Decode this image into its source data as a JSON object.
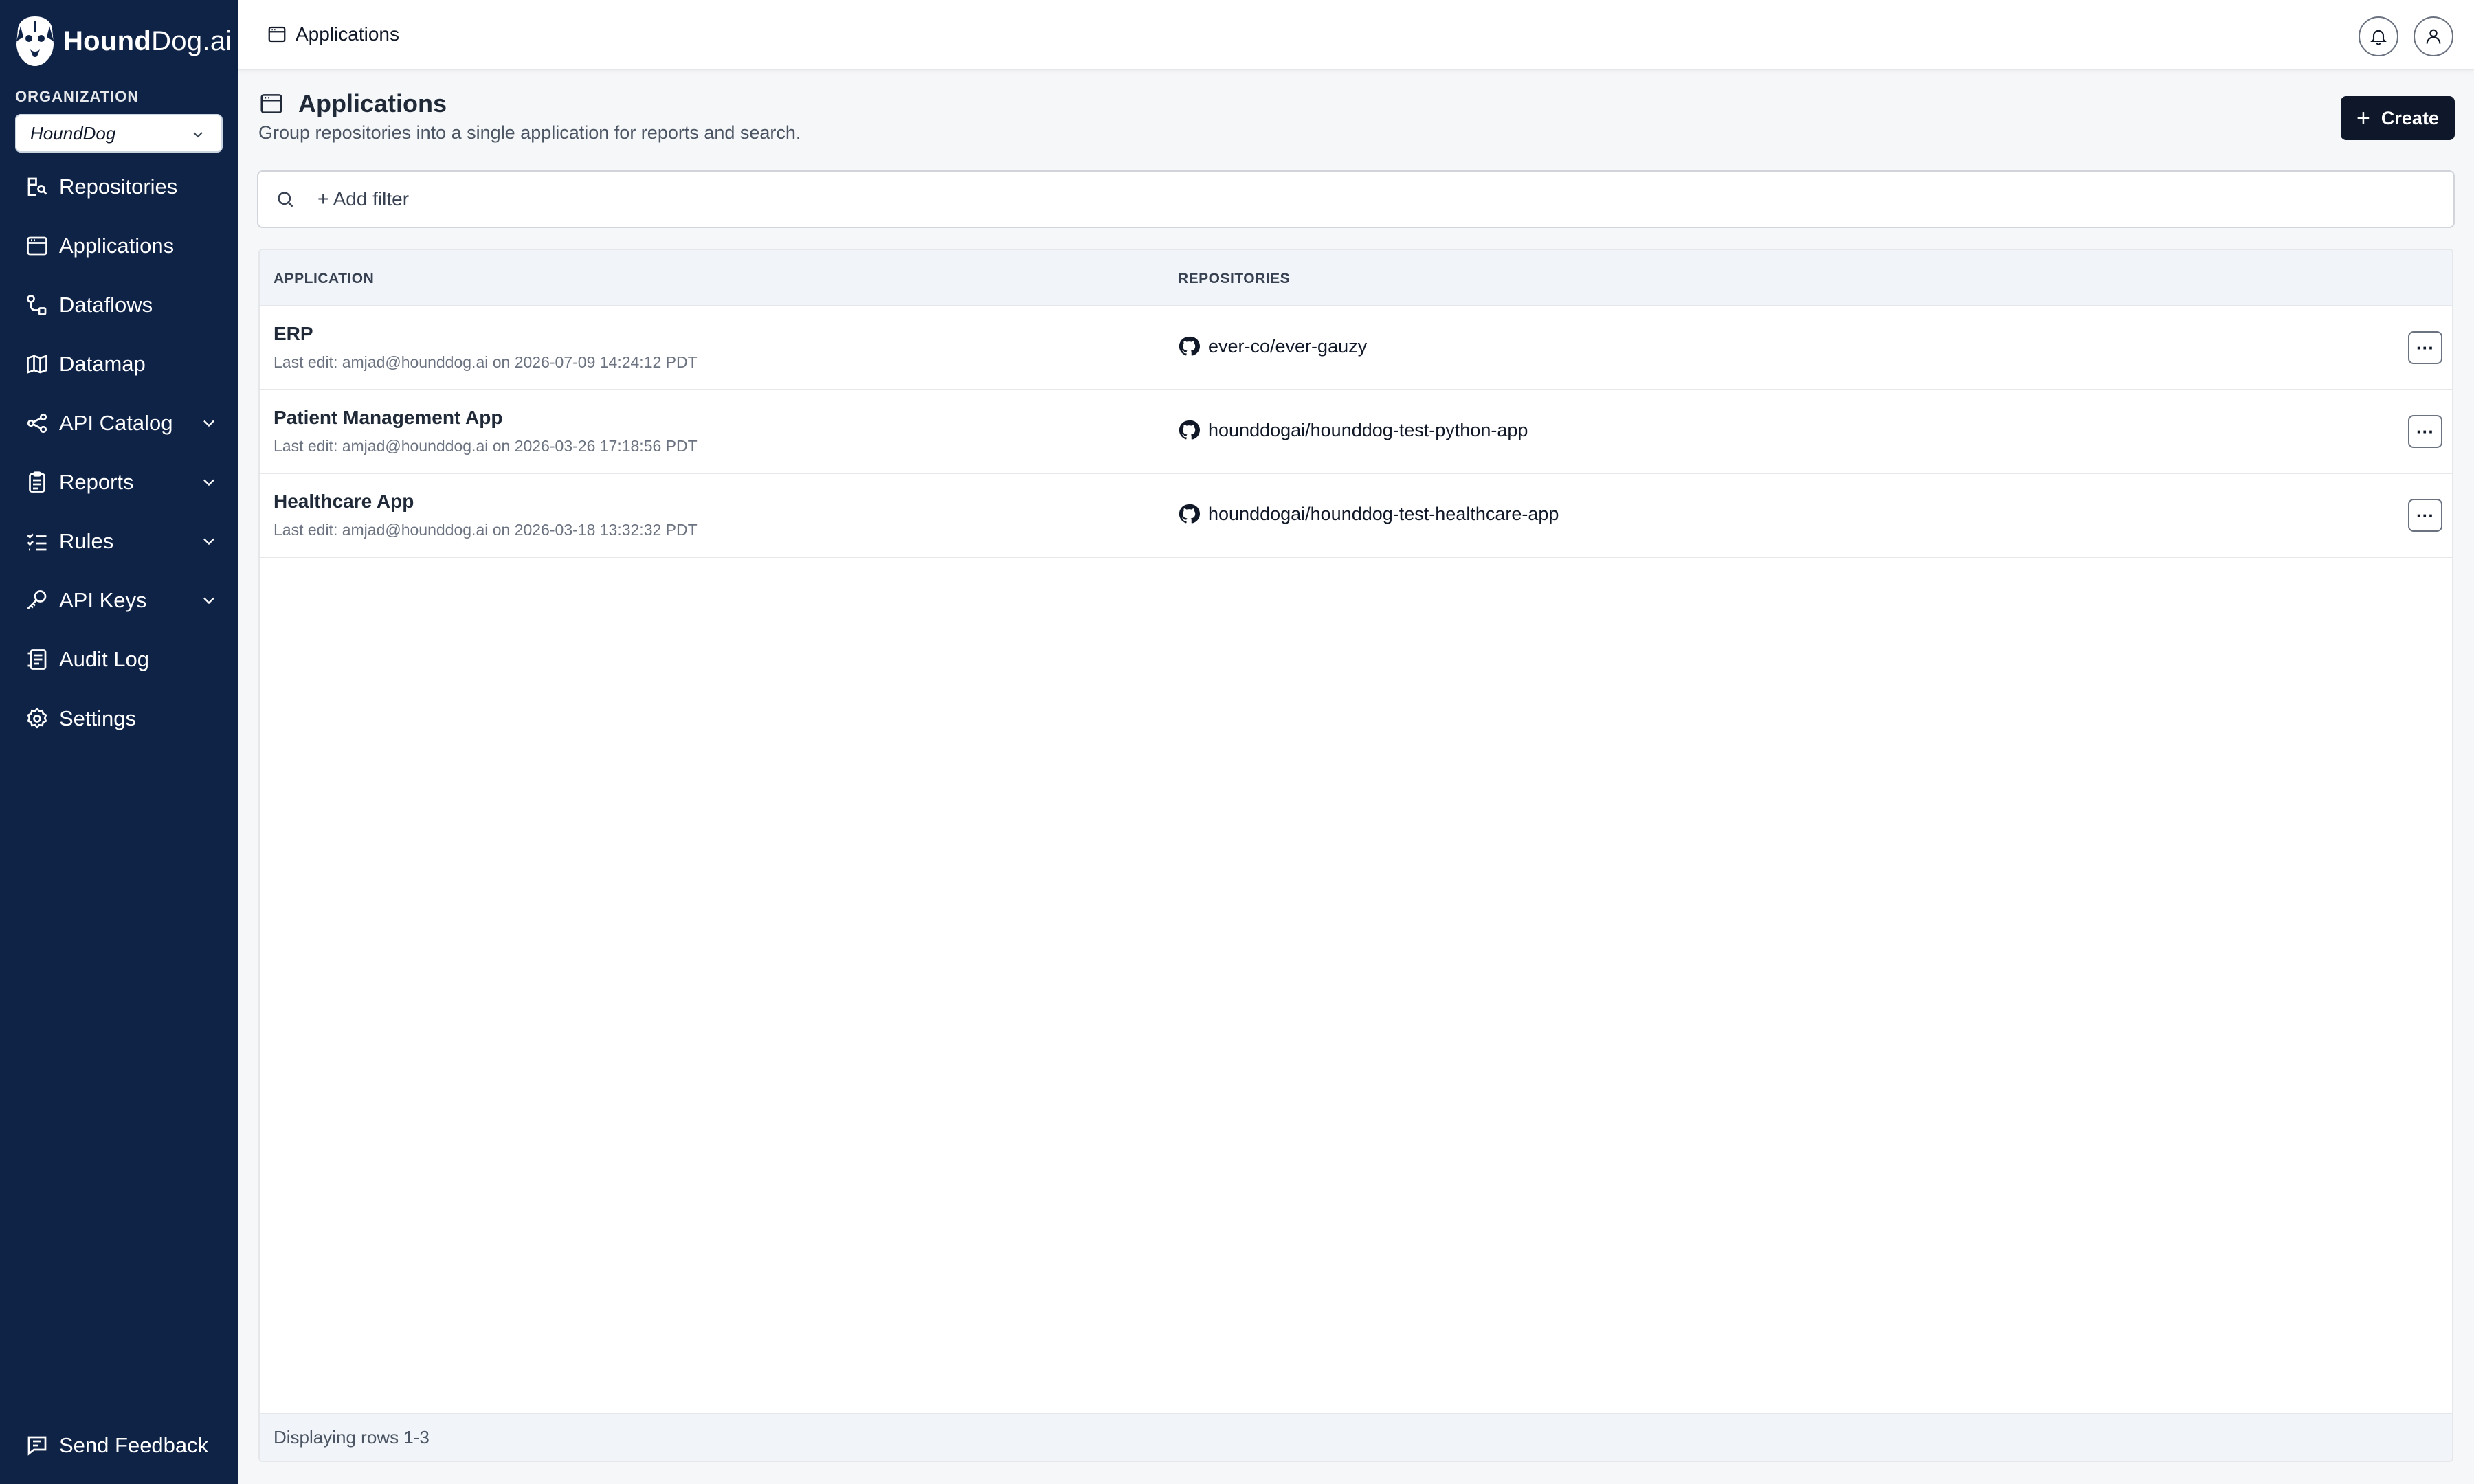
{
  "brand": {
    "name_bold": "Hound",
    "name_rest": "Dog.ai"
  },
  "sidebar": {
    "org_label": "ORGANIZATION",
    "org_value": "HoundDog",
    "items": [
      {
        "label": "Repositories",
        "icon": "repositories-icon"
      },
      {
        "label": "Applications",
        "icon": "applications-icon"
      },
      {
        "label": "Dataflows",
        "icon": "dataflows-icon"
      },
      {
        "label": "Datamap",
        "icon": "map-icon"
      },
      {
        "label": "API Catalog",
        "icon": "api-catalog-icon",
        "expandable": true
      },
      {
        "label": "Reports",
        "icon": "clipboard-icon",
        "expandable": true
      },
      {
        "label": "Rules",
        "icon": "checklist-icon",
        "expandable": true
      },
      {
        "label": "API Keys",
        "icon": "key-icon",
        "expandable": true
      },
      {
        "label": "Audit Log",
        "icon": "audit-log-icon"
      },
      {
        "label": "Settings",
        "icon": "gear-icon"
      }
    ],
    "feedback_label": "Send Feedback"
  },
  "topbar": {
    "breadcrumb": "Applications"
  },
  "header": {
    "title": "Applications",
    "subtitle": "Group repositories into a single application for reports and search.",
    "create_label": "Create"
  },
  "filter": {
    "placeholder": "+ Add filter"
  },
  "table": {
    "columns": [
      "APPLICATION",
      "REPOSITORIES"
    ],
    "rows": [
      {
        "name": "ERP",
        "edit": "Last edit: amjad@hounddog.ai on 2026-07-09 14:24:12 PDT",
        "repo": "ever-co/ever-gauzy"
      },
      {
        "name": "Patient Management App",
        "edit": "Last edit: amjad@hounddog.ai on 2026-03-26 17:18:56 PDT",
        "repo": "hounddogai/hounddog-test-python-app"
      },
      {
        "name": "Healthcare App",
        "edit": "Last edit: amjad@hounddog.ai on 2026-03-18 13:32:32 PDT",
        "repo": "hounddogai/hounddog-test-healthcare-app"
      }
    ],
    "more_label": "···",
    "footer": "Displaying rows 1-3"
  },
  "colors": {
    "sidebar_bg": "#0f2347",
    "button_dark": "#0f172a",
    "page_bg": "#f6f7f9"
  }
}
